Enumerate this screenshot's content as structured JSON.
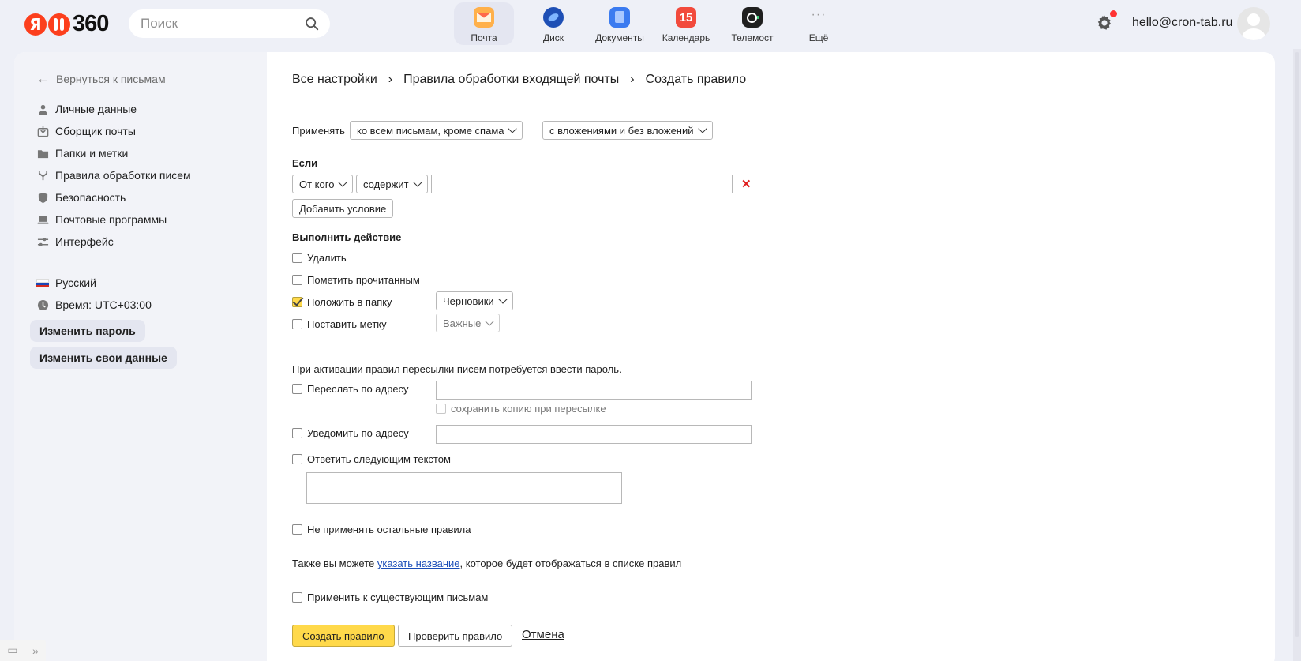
{
  "header": {
    "logo_text": "360",
    "search_placeholder": "Поиск",
    "services": [
      {
        "label": "Почта",
        "icon": "mail-icon"
      },
      {
        "label": "Диск",
        "icon": "disk-icon"
      },
      {
        "label": "Документы",
        "icon": "documents-icon"
      },
      {
        "label": "Календарь",
        "icon": "calendar-icon",
        "badge": "15"
      },
      {
        "label": "Телемост",
        "icon": "telemost-icon"
      },
      {
        "label": "Ещё",
        "icon": "more-icon",
        "glyph": "···"
      }
    ],
    "user_email": "hello@cron-tab.ru",
    "accent": "#fc3f1d"
  },
  "sidebar": {
    "back_label": "Вернуться к письмам",
    "items": [
      {
        "label": "Личные данные",
        "icon": "person-icon"
      },
      {
        "label": "Сборщик почты",
        "icon": "inbox-download-icon"
      },
      {
        "label": "Папки и метки",
        "icon": "folder-icon"
      },
      {
        "label": "Правила обработки писем",
        "icon": "branch-icon"
      },
      {
        "label": "Безопасность",
        "icon": "shield-icon"
      },
      {
        "label": "Почтовые программы",
        "icon": "laptop-icon"
      },
      {
        "label": "Интерфейс",
        "icon": "sliders-icon"
      }
    ],
    "language": "Русский",
    "time": "Время: UTC+03:00",
    "change_password": "Изменить пароль",
    "change_data": "Изменить свои данные"
  },
  "main": {
    "breadcrumbs": [
      "Все настройки",
      "Правила обработки входящей почты",
      "Создать правило"
    ],
    "apply_label": "Применять",
    "apply_scope": "ко всем письмам, кроме спама",
    "apply_attachments": "с вложениями и без вложений",
    "if_heading": "Если",
    "condition_field": "От кого",
    "condition_op": "содержит",
    "condition_value": "",
    "delete_glyph": "✕",
    "add_condition": "Добавить условие",
    "action_heading": "Выполнить действие",
    "actions": {
      "delete": "Удалить",
      "mark_read": "Пометить прочитанным",
      "move_folder": "Положить в папку",
      "folder_value": "Черновики",
      "set_label": "Поставить метку",
      "label_value": "Важные"
    },
    "forward_note": "При активации правил пересылки писем потребуется ввести пароль.",
    "forward_label": "Переслать по адресу",
    "keep_copy": "сохранить копию при пересылке",
    "notify_label": "Уведомить по адресу",
    "reply_label": "Ответить следующим текстом",
    "stop_rules": "Не применять остальные правила",
    "name_text_before": "Также вы можете ",
    "name_link": "указать название",
    "name_text_after": ", которое будет отображаться в списке правил",
    "apply_existing": "Применить к существующим письмам",
    "create_button": "Создать правило",
    "check_button": "Проверить правило",
    "cancel": "Отмена"
  }
}
